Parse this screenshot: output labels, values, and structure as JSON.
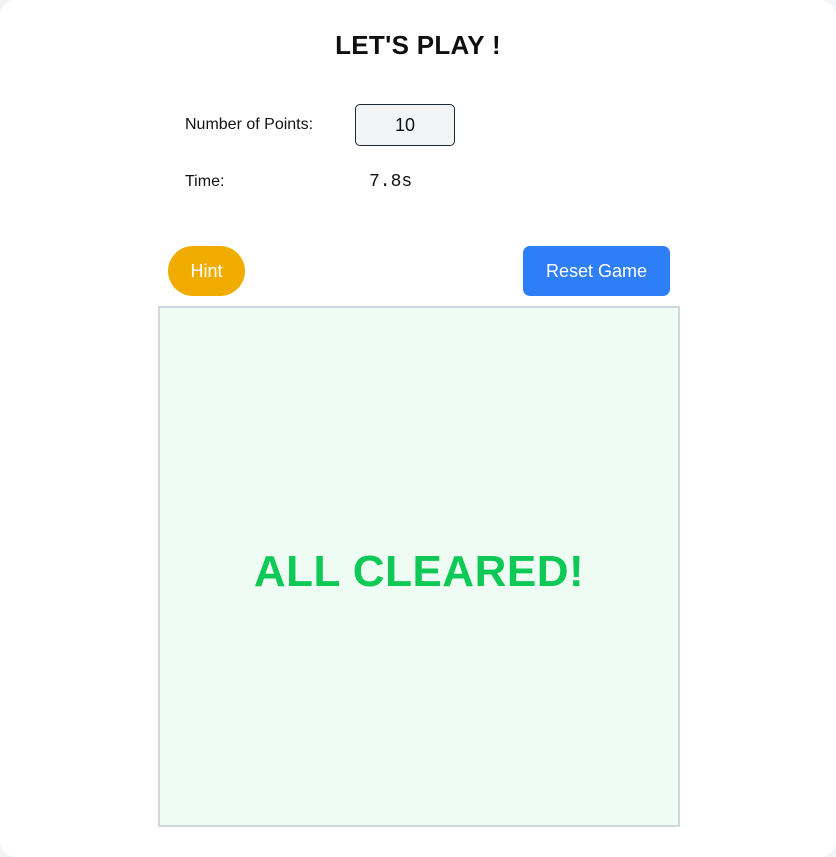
{
  "header": {
    "title": "LET'S PLAY !"
  },
  "settings": {
    "points_label": "Number of Points:",
    "points_value": "10",
    "time_label": "Time:",
    "time_value": "7.8s"
  },
  "controls": {
    "hint_label": "Hint",
    "reset_label": "Reset Game"
  },
  "board": {
    "status_message": "ALL CLEARED!"
  },
  "colors": {
    "hint_button": "#f0ad00",
    "reset_button": "#2e7ff7",
    "board_background": "#effcf3",
    "success_text": "#0ec956"
  }
}
